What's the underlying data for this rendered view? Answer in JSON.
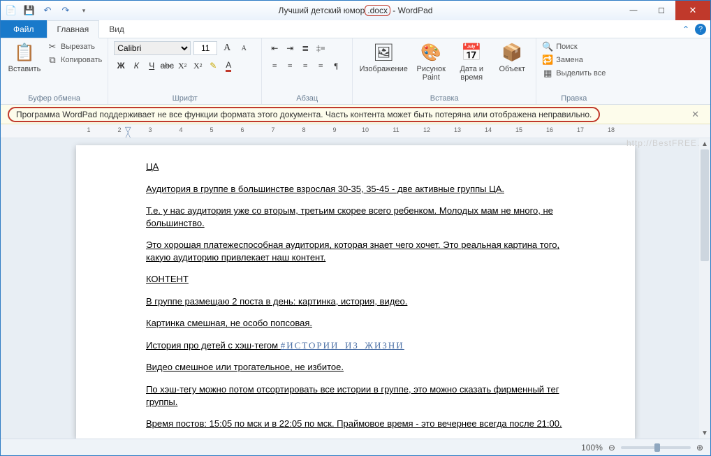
{
  "title": {
    "prefix": "Лучший детский юмор",
    "ext": ".docx",
    "suffix": " - WordPad"
  },
  "qat": {
    "save": "💾",
    "undo": "↶",
    "redo": "↷"
  },
  "tabs": {
    "file": "Файл",
    "home": "Главная",
    "view": "Вид"
  },
  "ribbon": {
    "clipboard": {
      "paste": "Вставить",
      "cut": "Вырезать",
      "copy": "Копировать",
      "label": "Буфер обмена"
    },
    "font": {
      "name": "Calibri",
      "size": "11",
      "label": "Шрифт"
    },
    "paragraph": {
      "label": "Абзац"
    },
    "insert": {
      "image": "Изображение",
      "paint": "Рисунок Paint",
      "datetime": "Дата и время",
      "object": "Объект",
      "label": "Вставка"
    },
    "editing": {
      "find": "Поиск",
      "replace": "Замена",
      "selectall": "Выделить все",
      "label": "Правка"
    }
  },
  "warning": "Программа WordPad поддерживает не все функции формата этого документа. Часть контента может быть потеряна или отображена неправильно.",
  "document": {
    "p1": "ЦА",
    "p2": "Аудитория в группе в большинстве взрослая 30-35, 35-45 - две активные группы ЦА.",
    "p3": "Т.е. у нас аудитория уже со вторым, третьим скорее всего ребенком. Молодых мам не много, не большинство.",
    "p4": "Это хорошая платежеспособная аудитория, которая знает чего хочет. Это реальная картина того, какую аудиторию привлекает наш контент.",
    "p5": "КОНТЕНТ",
    "p6": "В группе размещаю 2 поста в день: картинка,  история, видео.",
    "p7": "Картинка смешная, не особо попсовая.",
    "p8a": "История про детей с хэш-тегом ",
    "p8b": "#ИСТОРИИ_ИЗ_ЖИЗНИ",
    "p9": "Видео смешное или трогательное, не избитое.",
    "p10": "По хэш-тегу можно потом отсортировать все истории в группе, это можно сказать фирменный тег группы.",
    "p11": "Время постов: 15:05  по мск и в 22:05  по мск. Праймовое время - это вечернее всегда после 21:00."
  },
  "watermark": "http://BestFREE.ru",
  "status": {
    "zoom": "100%"
  }
}
